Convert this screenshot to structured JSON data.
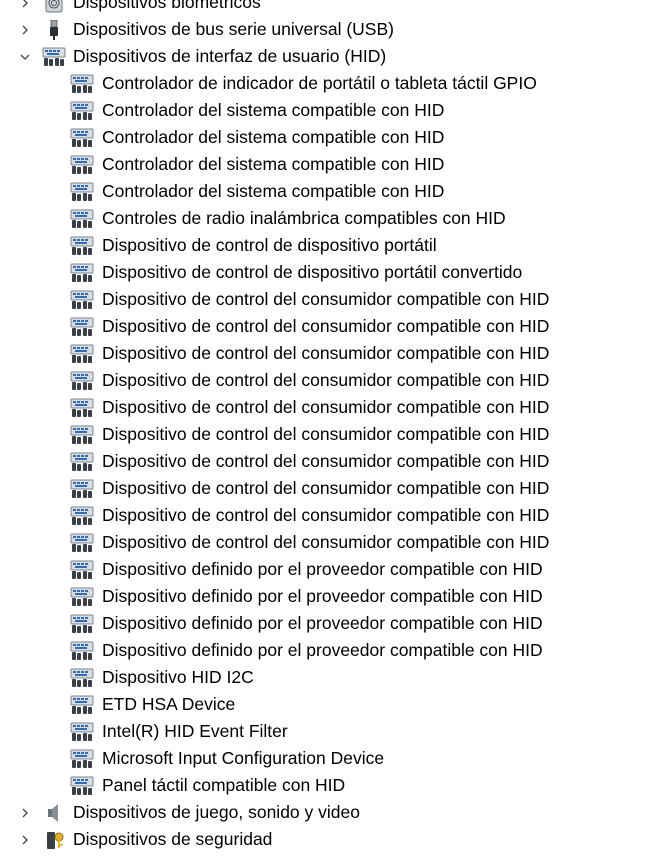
{
  "window": {
    "title": ""
  },
  "tree": {
    "categories_before": [
      {
        "label": "Dispositivos biométricos",
        "icon": "fingerprint-icon",
        "expanded": false
      },
      {
        "label": "Dispositivos de bus serie universal (USB)",
        "icon": "usb-icon",
        "expanded": false
      }
    ],
    "hid_category": {
      "label": "Dispositivos de interfaz de usuario (HID)",
      "icon": "hid-device-icon",
      "expanded": true,
      "children": [
        "Controlador de indicador de portátil o tableta táctil GPIO",
        "Controlador del sistema compatible con HID",
        "Controlador del sistema compatible con HID",
        "Controlador del sistema compatible con HID",
        "Controlador del sistema compatible con HID",
        "Controles de radio inalámbrica compatibles con HID",
        "Dispositivo de control de dispositivo portátil",
        "Dispositivo de control de dispositivo portátil convertido",
        "Dispositivo de control del consumidor compatible con HID",
        "Dispositivo de control del consumidor compatible con HID",
        "Dispositivo de control del consumidor compatible con HID",
        "Dispositivo de control del consumidor compatible con HID",
        "Dispositivo de control del consumidor compatible con HID",
        "Dispositivo de control del consumidor compatible con HID",
        "Dispositivo de control del consumidor compatible con HID",
        "Dispositivo de control del consumidor compatible con HID",
        "Dispositivo de control del consumidor compatible con HID",
        "Dispositivo de control del consumidor compatible con HID",
        "Dispositivo definido por el proveedor compatible con HID",
        "Dispositivo definido por el proveedor compatible con HID",
        "Dispositivo definido por el proveedor compatible con HID",
        "Dispositivo definido por el proveedor compatible con HID",
        "Dispositivo HID I2C",
        "ETD HSA Device",
        "Intel(R) HID Event Filter",
        "Microsoft Input Configuration Device",
        "Panel táctil compatible con HID"
      ]
    },
    "categories_after": [
      {
        "label": "Dispositivos de juego, sonido y video",
        "icon": "speaker-icon",
        "expanded": false
      },
      {
        "label": "Dispositivos de seguridad",
        "icon": "security-key-icon",
        "expanded": false
      }
    ]
  },
  "colors": {
    "icon_body": "#7a8590",
    "icon_keys": "#2f6db5",
    "chevron": "#444444"
  }
}
